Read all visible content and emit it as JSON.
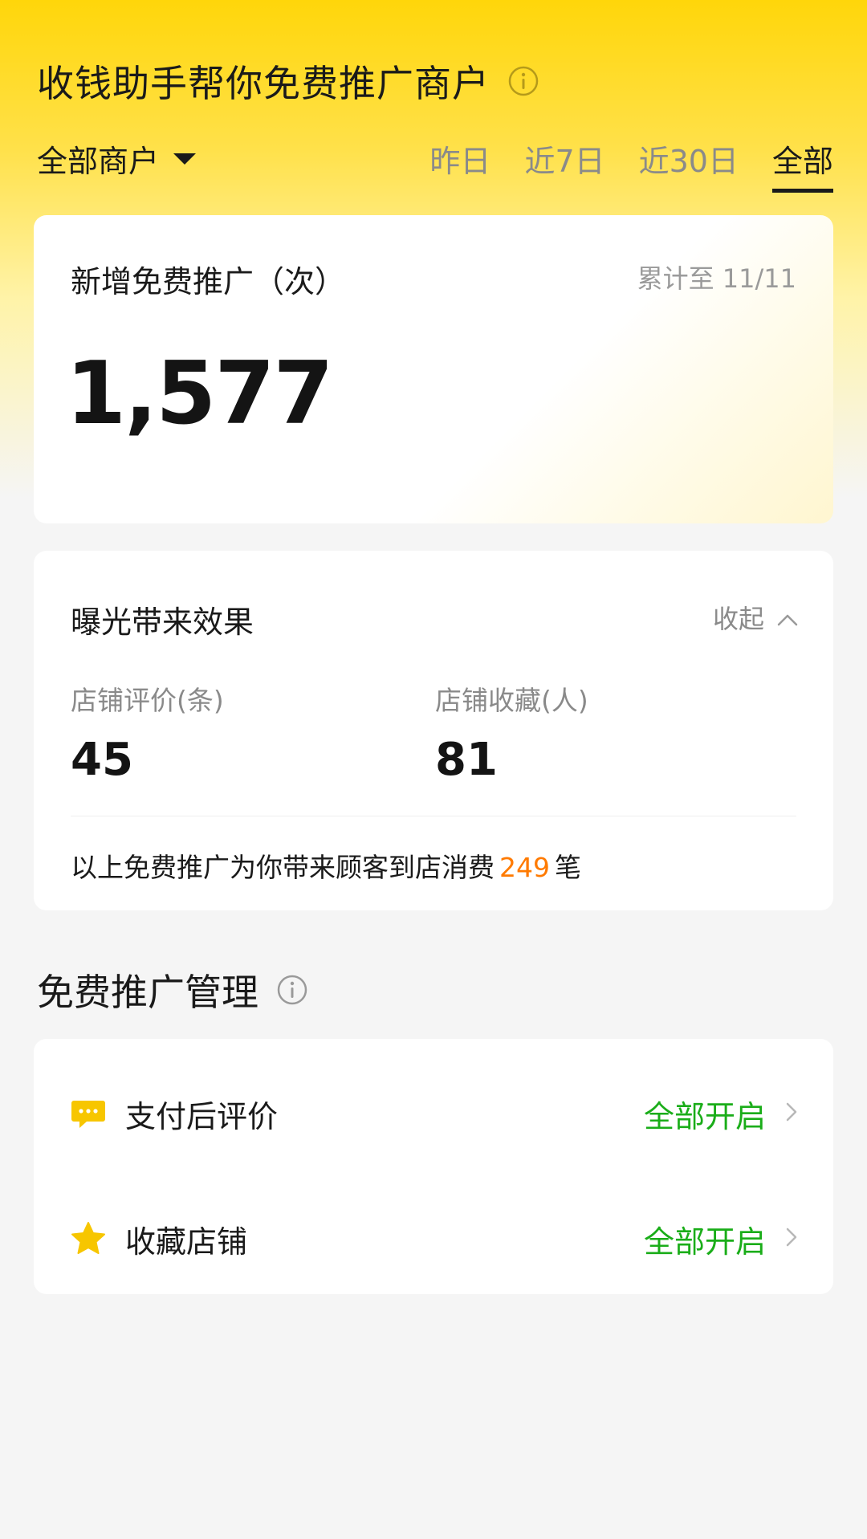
{
  "header": {
    "title": "收钱助手帮你免费推广商户",
    "info_icon": "info-circle-icon"
  },
  "filter": {
    "merchant_select": "全部商户",
    "periods": [
      {
        "label": "昨日",
        "active": false
      },
      {
        "label": "近7日",
        "active": false
      },
      {
        "label": "近30日",
        "active": false
      },
      {
        "label": "全部",
        "active": true
      }
    ]
  },
  "promo_card": {
    "title": "新增免费推广（次）",
    "cumulative": "累计至 11/11",
    "value": "1,577"
  },
  "effect_card": {
    "title": "曝光带来效果",
    "collapse_label": "收起",
    "metrics": [
      {
        "label": "店铺评价(条)",
        "value": "45"
      },
      {
        "label": "店铺收藏(人)",
        "value": "81"
      }
    ],
    "summary_prefix": "以上免费推广为你带来顾客到店消费",
    "summary_count": "249",
    "summary_suffix": "笔"
  },
  "manage_section": {
    "title": "免费推广管理",
    "rows": [
      {
        "label": "支付后评价",
        "status": "全部开启",
        "icon": "chat-bubble-icon"
      },
      {
        "label": "收藏店铺",
        "status": "全部开启",
        "icon": "star-icon"
      }
    ]
  },
  "colors": {
    "brand_yellow": "#ffd60a",
    "status_green": "#1aad19",
    "highlight_orange": "#ff7a00",
    "icon_yellow": "#f7c600"
  }
}
